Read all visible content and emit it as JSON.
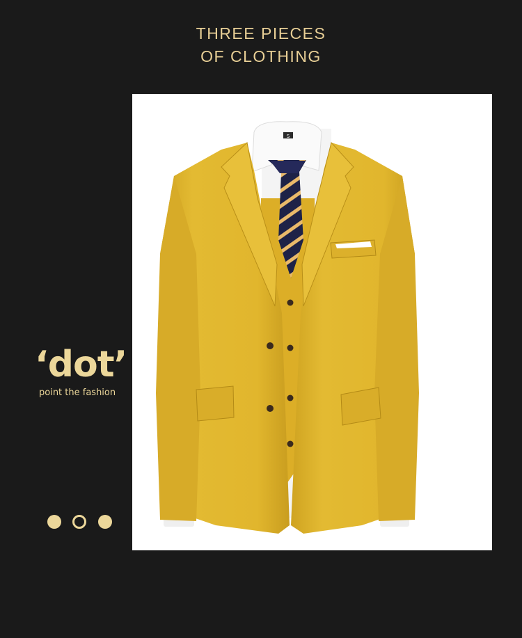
{
  "header": {
    "line1": "THREE PIECES",
    "line2": "OF CLOTHING"
  },
  "brand": {
    "mark": "‘dot’",
    "tagline": "point the fashion"
  },
  "product_image": {
    "subject": "yellow three-piece suit",
    "shirt_label": "S"
  },
  "carousel": {
    "indicators": [
      "filled",
      "hollow",
      "filled"
    ]
  },
  "colors": {
    "background": "#1a1a1a",
    "accent_gold": "#ecd79a",
    "suit_yellow": "#e0b52c",
    "tie_navy": "#1e2247"
  }
}
